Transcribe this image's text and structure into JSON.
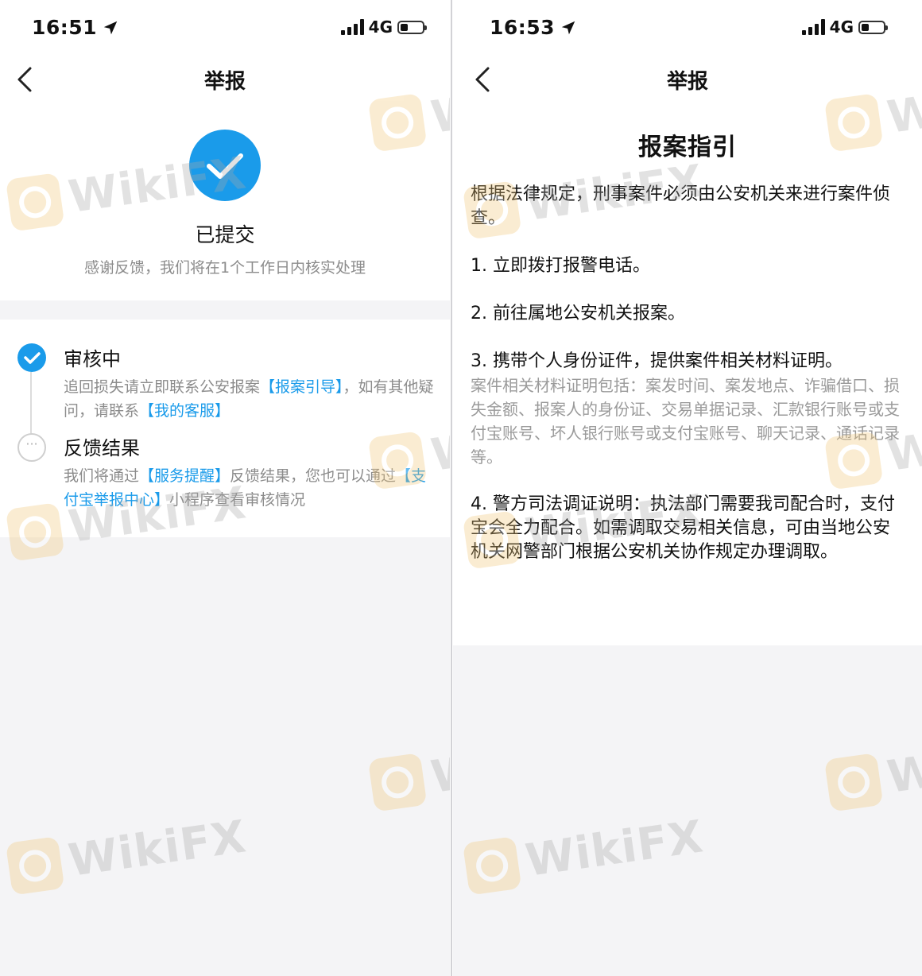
{
  "left_screen": {
    "status": {
      "time": "16:51",
      "network": "4G"
    },
    "nav": {
      "title": "举报"
    },
    "result": {
      "title": "已提交",
      "description": "感谢反馈，我们将在1个工作日内核实处理"
    },
    "steps": [
      {
        "title": "审核中",
        "desc_part1": "追回损失请立即联系公安报案",
        "link1": "【报案引导】",
        "desc_part2": "，如有其他疑问，请联系",
        "link2": "【我的客服】"
      },
      {
        "title": "反馈结果",
        "desc_part1": "我们将通过",
        "link1": "【服务提醒】",
        "desc_part2": "反馈结果，您也可以通过",
        "link2": "【支付宝举报中心】",
        "desc_part3": "小程序查看审核情况"
      }
    ]
  },
  "right_screen": {
    "status": {
      "time": "16:53",
      "network": "4G"
    },
    "nav": {
      "title": "举报"
    },
    "guide": {
      "title": "报案指引",
      "intro": "根据法律规定，刑事案件必须由公安机关来进行案件侦查。",
      "item1": "1. 立即拨打报警电话。",
      "item2": "2. 前往属地公安机关报案。",
      "item3": "3. 携带个人身份证件，提供案件相关材料证明。",
      "item3_note": "案件相关材料证明包括：案发时间、案发地点、诈骗借口、损失金额、报案人的身份证、交易单据记录、汇款银行账号或支付宝账号、坏人银行账号或支付宝账号、聊天记录、通话记录等。",
      "item4": "4. 警方司法调证说明：执法部门需要我司配合时，支付宝会全力配合。如需调取交易相关信息，可由当地公安机关网警部门根据公安机关协作规定办理调取。"
    }
  },
  "watermark": {
    "text": "WikiFX"
  },
  "colors": {
    "accent": "#1a9bea",
    "muted_text": "#8c8c8c",
    "watermark_logo": "#f2c777"
  },
  "icons": [
    "location-arrow-icon",
    "signal-icon",
    "battery-icon",
    "back-chevron-icon",
    "checkmark-icon",
    "more-dots-icon",
    "wikifx-logo-icon"
  ]
}
